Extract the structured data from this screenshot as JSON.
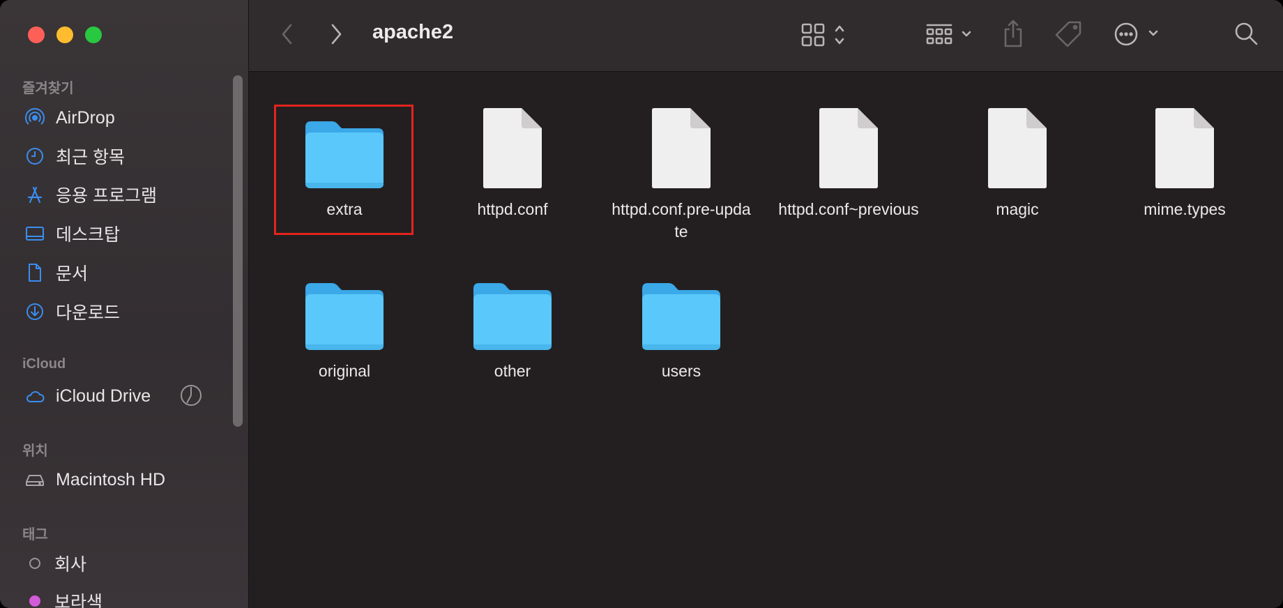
{
  "window": {
    "title": "apache2"
  },
  "sidebar": {
    "favorites_header": "즐겨찾기",
    "favorites": [
      {
        "label": "AirDrop",
        "icon": "airdrop-icon"
      },
      {
        "label": "최근 항목",
        "icon": "clock-icon"
      },
      {
        "label": "응용 프로그램",
        "icon": "applications-icon"
      },
      {
        "label": "데스크탑",
        "icon": "desktop-icon"
      },
      {
        "label": "문서",
        "icon": "document-icon"
      },
      {
        "label": "다운로드",
        "icon": "download-icon"
      }
    ],
    "icloud_header": "iCloud",
    "icloud": [
      {
        "label": "iCloud Drive",
        "icon": "cloud-icon"
      }
    ],
    "locations_header": "위치",
    "locations": [
      {
        "label": "Macintosh HD",
        "icon": "harddrive-icon"
      }
    ],
    "tags_header": "태그",
    "tags": [
      {
        "label": "회사",
        "color": "none"
      },
      {
        "label": "보라색",
        "color": "#d25bd9"
      }
    ]
  },
  "toolbar": {
    "back_icon": "chevron-left-icon",
    "forward_icon": "chevron-right-icon",
    "view_icon": "grid-view-icon",
    "group_icon": "group-icon",
    "share_icon": "share-icon",
    "tag_icon": "tag-icon",
    "more_icon": "ellipsis-icon",
    "search_icon": "search-icon"
  },
  "files": [
    {
      "name": "extra",
      "kind": "folder",
      "selected": true
    },
    {
      "name": "httpd.conf",
      "kind": "file"
    },
    {
      "name": "httpd.conf.pre-update",
      "kind": "file"
    },
    {
      "name": "httpd.conf~previous",
      "kind": "file"
    },
    {
      "name": "magic",
      "kind": "file"
    },
    {
      "name": "mime.types",
      "kind": "file"
    },
    {
      "name": "original",
      "kind": "folder"
    },
    {
      "name": "other",
      "kind": "folder"
    },
    {
      "name": "users",
      "kind": "folder"
    }
  ],
  "colors": {
    "accent": "#3a8ef0",
    "folder": "#5ac8fa",
    "selection_outline": "#e3241c"
  }
}
